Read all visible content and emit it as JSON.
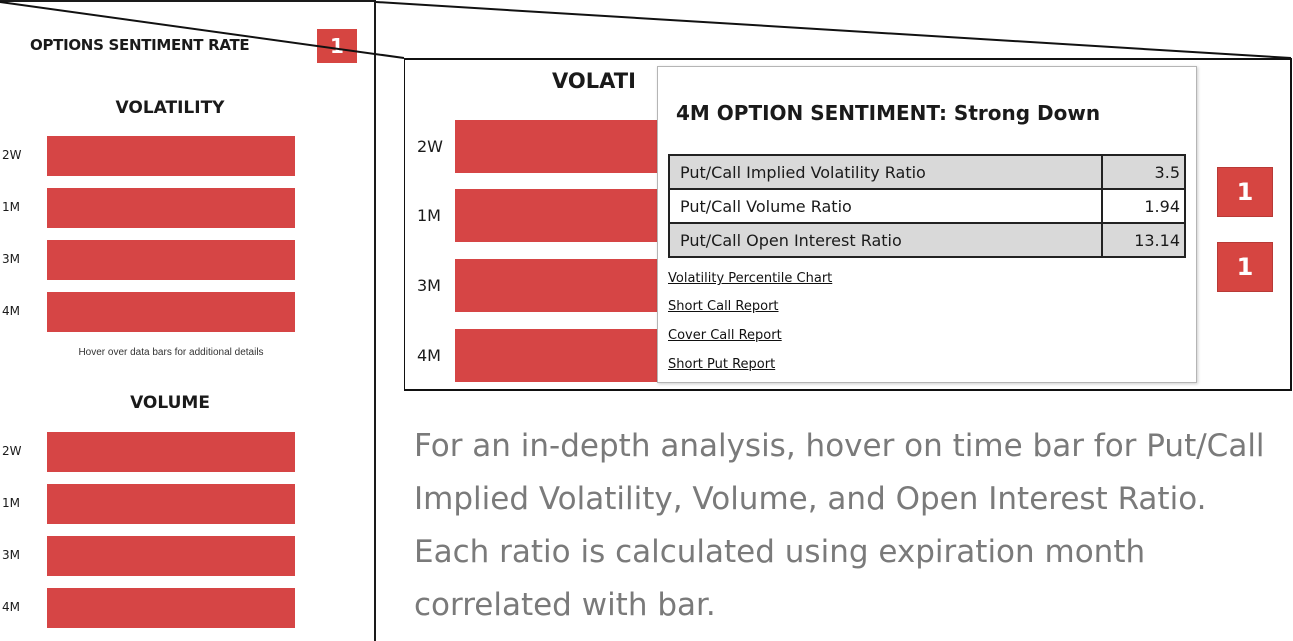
{
  "left_widget": {
    "title": "OPTIONS SENTIMENT RATE",
    "badge": "1",
    "volatility_heading": "VOLATILITY",
    "volatility_bars": [
      {
        "label": "2W"
      },
      {
        "label": "1M"
      },
      {
        "label": "3M"
      },
      {
        "label": "4M"
      }
    ],
    "hint": "Hover over data bars for additional details",
    "volume_heading": "VOLUME",
    "volume_bars": [
      {
        "label": "2W"
      },
      {
        "label": "1M"
      },
      {
        "label": "3M"
      },
      {
        "label": "4M"
      }
    ]
  },
  "zoom": {
    "section_heading": "VOLATI",
    "bars": [
      {
        "label": "2W"
      },
      {
        "label": "1M"
      },
      {
        "label": "3M"
      },
      {
        "label": "4M"
      }
    ],
    "badges": [
      "1",
      "1"
    ]
  },
  "tooltip": {
    "title": "4M OPTION SENTIMENT: Strong Down",
    "rows": [
      {
        "label": "Put/Call Implied Volatility Ratio",
        "value": "3.5"
      },
      {
        "label": "Put/Call Volume Ratio",
        "value": "1.94"
      },
      {
        "label": "Put/Call Open Interest Ratio",
        "value": "13.14"
      }
    ],
    "links": [
      "Volatility Percentile Chart",
      "Short Call Report",
      "Cover Call Report",
      "Short Put Report"
    ]
  },
  "caption": "For an in-depth analysis, hover on time bar for Put/Call Implied Volatility, Volume, and Open Interest Ratio. Each ratio is calculated using expiration month correlated with bar.",
  "colors": {
    "bar_red": "#d64545",
    "caption_gray": "#7a7a7a"
  }
}
